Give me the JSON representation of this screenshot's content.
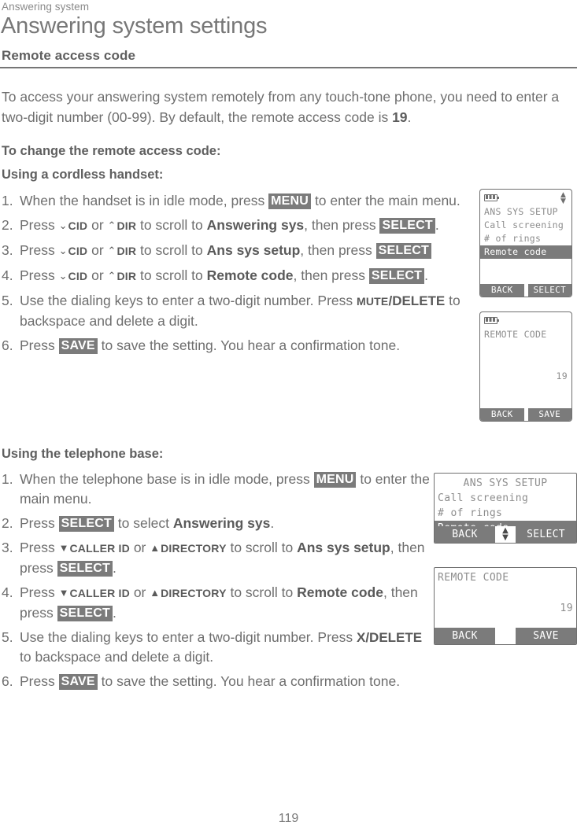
{
  "document": {
    "running_head": "Answering system",
    "page_title": "Answering system settings",
    "section_heading": "Remote access code",
    "intro_part1": "To access your answering system remotely from any touch-tone phone, you need to enter a two-digit number (00-99). By default, the remote access code is ",
    "intro_code": "19",
    "intro_part2": ".",
    "page_number": "119"
  },
  "subheads": {
    "to_change": "To change the remote access code:",
    "cordless": "Using a cordless handset:",
    "base": "Using the telephone base:"
  },
  "keys": {
    "menu": "MENU",
    "select": "SELECT",
    "save": "SAVE",
    "cid": "CID",
    "dir": "DIR",
    "caller_id": "CALLER ID",
    "directory": "DIRECTORY",
    "mute_delete_small": "MUTE",
    "mute_delete_rest": "/DELETE",
    "x_delete": "X/DELETE",
    "down_chevron": "⌄",
    "up_chevron": "⌃",
    "down_triangle": "▼",
    "up_triangle": "▲"
  },
  "cordless_steps": [
    {
      "num": "1.",
      "a": "When the handset is in idle mode, press ",
      "key": "MENU",
      "b": " to enter the main menu."
    },
    {
      "num": "2.",
      "a": "Press ",
      "arrow1": "⌄",
      "k1": "CID",
      "mid1": " or ",
      "arrow2": "⌃",
      "k2": "DIR",
      "mid2": " to scroll to ",
      "bold": "Answering sys",
      "mid3": ", then press ",
      "key": "SELECT",
      "b": "."
    },
    {
      "num": "3.",
      "a": "Press ",
      "arrow1": "⌄",
      "k1": "CID",
      "mid1": " or ",
      "arrow2": "⌃",
      "k2": "DIR",
      "mid2": " to scroll to ",
      "bold": "Ans sys setup",
      "mid3": ", then press ",
      "key": "SELECT",
      "b": ""
    },
    {
      "num": "4.",
      "a": "Press ",
      "arrow1": "⌄",
      "k1": "CID",
      "mid1": " or ",
      "arrow2": "⌃",
      "k2": "DIR",
      "mid2": " to scroll to ",
      "bold": "Remote code",
      "mid3": ", then press ",
      "key": "SELECT",
      "b": "."
    },
    {
      "num": "5.",
      "a": "Use the dialing keys to enter a two-digit number. Press ",
      "key_small": "MUTE",
      "key_rest": "/DELETE",
      "b": " to backspace and delete a digit."
    },
    {
      "num": "6.",
      "a": "Press ",
      "key": "SAVE",
      "b": " to save the setting. You hear a confirmation tone."
    }
  ],
  "base_steps": [
    {
      "num": "1.",
      "a": "When the telephone base is in idle mode, press ",
      "key": "MENU",
      "b": " to enter the main menu."
    },
    {
      "num": "2.",
      "a": "Press ",
      "key": "SELECT",
      "mid": " to select ",
      "bold": "Answering sys",
      "b": "."
    },
    {
      "num": "3.",
      "a": "Press ",
      "arrow1": "▼",
      "k1": "CALLER ID",
      "mid1": " or ",
      "arrow2": "▲",
      "k2": "DIRECTORY",
      "mid2": " to scroll to ",
      "bold": "Ans sys setup",
      "mid3": ", then press ",
      "key": "SELECT",
      "b": "."
    },
    {
      "num": "4.",
      "a": "Press ",
      "arrow1": "▼",
      "k1": "CALLER ID",
      "mid1": " or ",
      "arrow2": "▲",
      "k2": "DIRECTORY",
      "mid2": " to scroll to ",
      "bold": "Remote code",
      "mid3": ", then press ",
      "key": "SELECT",
      "b": "."
    },
    {
      "num": "5.",
      "a": "Use the dialing keys to enter a two-digit number. Press ",
      "key_bold": "X/DELETE",
      "b": " to backspace and delete a digit."
    },
    {
      "num": "6.",
      "a": "Press ",
      "key": "SAVE",
      "b": " to save the setting. You hear a confirmation tone."
    }
  ],
  "screens": {
    "handset_menu": {
      "device": "cordless-handset",
      "battery_icon": "battery-full-icon",
      "scroll_icon": "up-down-arrow-icon",
      "title": "ANS SYS SETUP",
      "rows": [
        "Call screening",
        "# of rings"
      ],
      "highlighted_row": "Remote code",
      "softkey_left": "BACK",
      "softkey_right": "SELECT"
    },
    "handset_code": {
      "device": "cordless-handset",
      "battery_icon": "battery-full-icon",
      "title": "REMOTE CODE",
      "value": "19",
      "softkey_left": "BACK",
      "softkey_right": "SAVE"
    },
    "base_menu": {
      "device": "telephone-base",
      "title": "ANS SYS SETUP",
      "rows": [
        "Call screening",
        "# of rings"
      ],
      "highlighted_row": "Remote code",
      "softkey_left": "BACK",
      "scroll_icon": "up-down-arrow-icon",
      "softkey_right": "SELECT"
    },
    "base_code": {
      "device": "telephone-base",
      "title": "REMOTE CODE",
      "value": "19",
      "softkey_left": "BACK",
      "softkey_right": "SAVE"
    }
  },
  "colors": {
    "key_pill_bg": "#7b7b7b",
    "text": "#6e6e6e",
    "rule": "#767676",
    "lcd_border": "#6f6f6f",
    "lcd_text": "#8d8d8d"
  }
}
